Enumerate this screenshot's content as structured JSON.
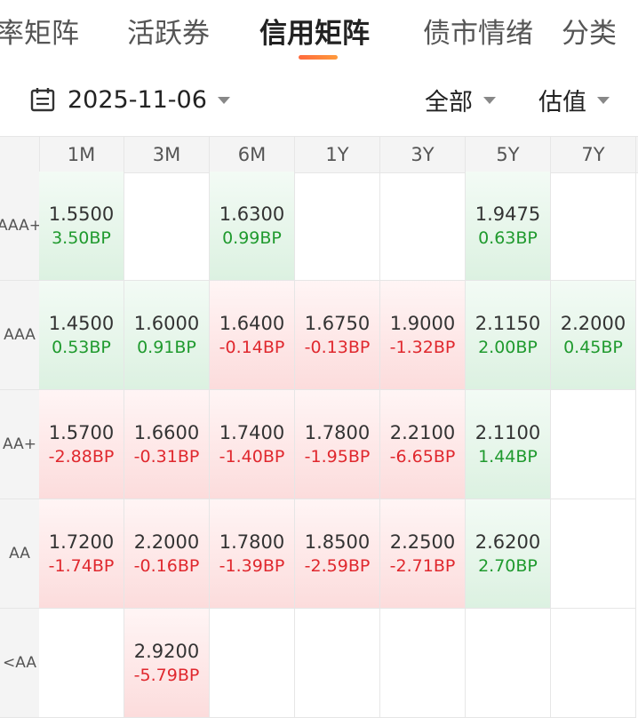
{
  "tabs": [
    {
      "label": "率矩阵"
    },
    {
      "label": "活跃券"
    },
    {
      "label": "信用矩阵"
    },
    {
      "label": "债市情绪"
    },
    {
      "label": "分类"
    }
  ],
  "filters": {
    "date": "2025-11-06",
    "scope": "全部",
    "price_type": "估值"
  },
  "matrix": {
    "columns": [
      "1M",
      "3M",
      "6M",
      "1Y",
      "3Y",
      "5Y",
      "7Y"
    ],
    "rows": [
      {
        "label": "AAA+",
        "cells": [
          {
            "value": "1.5500",
            "change": "3.50BP",
            "dir": "up"
          },
          null,
          {
            "value": "1.6300",
            "change": "0.99BP",
            "dir": "up"
          },
          null,
          null,
          {
            "value": "1.9475",
            "change": "0.63BP",
            "dir": "up"
          },
          null
        ]
      },
      {
        "label": "AAA",
        "cells": [
          {
            "value": "1.4500",
            "change": "0.53BP",
            "dir": "up"
          },
          {
            "value": "1.6000",
            "change": "0.91BP",
            "dir": "up"
          },
          {
            "value": "1.6400",
            "change": "-0.14BP",
            "dir": "down"
          },
          {
            "value": "1.6750",
            "change": "-0.13BP",
            "dir": "down"
          },
          {
            "value": "1.9000",
            "change": "-1.32BP",
            "dir": "down"
          },
          {
            "value": "2.1150",
            "change": "2.00BP",
            "dir": "up"
          },
          {
            "value": "2.2000",
            "change": "0.45BP",
            "dir": "up"
          }
        ]
      },
      {
        "label": "AA+",
        "cells": [
          {
            "value": "1.5700",
            "change": "-2.88BP",
            "dir": "down"
          },
          {
            "value": "1.6600",
            "change": "-0.31BP",
            "dir": "down"
          },
          {
            "value": "1.7400",
            "change": "-1.40BP",
            "dir": "down"
          },
          {
            "value": "1.7800",
            "change": "-1.95BP",
            "dir": "down"
          },
          {
            "value": "2.2100",
            "change": "-6.65BP",
            "dir": "down"
          },
          {
            "value": "2.1100",
            "change": "1.44BP",
            "dir": "up"
          },
          null
        ]
      },
      {
        "label": "AA",
        "cells": [
          {
            "value": "1.7200",
            "change": "-1.74BP",
            "dir": "down"
          },
          {
            "value": "2.2000",
            "change": "-0.16BP",
            "dir": "down"
          },
          {
            "value": "1.7800",
            "change": "-1.39BP",
            "dir": "down"
          },
          {
            "value": "1.8500",
            "change": "-2.59BP",
            "dir": "down"
          },
          {
            "value": "2.2500",
            "change": "-2.71BP",
            "dir": "down"
          },
          {
            "value": "2.6200",
            "change": "2.70BP",
            "dir": "up"
          },
          null
        ]
      },
      {
        "label": "<AA",
        "cells": [
          null,
          {
            "value": "2.9200",
            "change": "-5.79BP",
            "dir": "down"
          },
          null,
          null,
          null,
          null,
          null
        ]
      }
    ]
  },
  "colors": {
    "up": "#1f9a2e",
    "down": "#e0282e",
    "accent": "#ff6a3d"
  }
}
